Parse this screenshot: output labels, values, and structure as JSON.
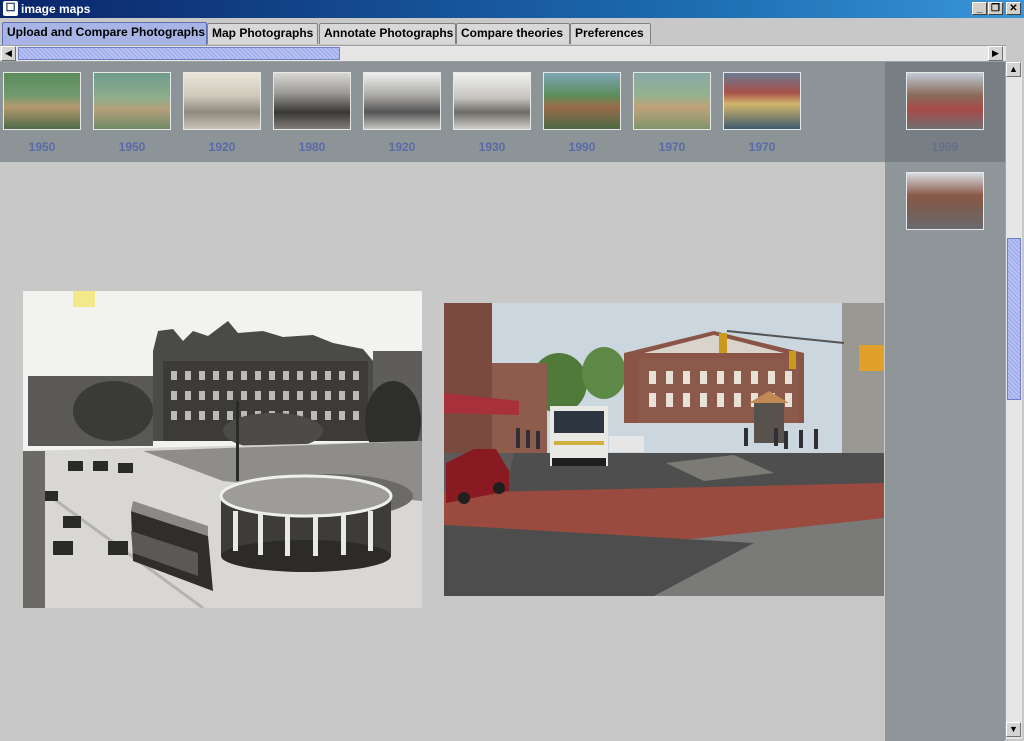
{
  "window": {
    "title": "image maps"
  },
  "tabs": [
    {
      "label": "Upload and Compare Photographs"
    },
    {
      "label": "Map Photographs"
    },
    {
      "label": "Annotate Photographs"
    },
    {
      "label": "Compare theories"
    },
    {
      "label": "Preferences"
    }
  ],
  "thumbnails": [
    {
      "year": "1950"
    },
    {
      "year": "1950"
    },
    {
      "year": "1920"
    },
    {
      "year": "1980"
    },
    {
      "year": "1920"
    },
    {
      "year": "1930"
    },
    {
      "year": "1990"
    },
    {
      "year": "1970"
    },
    {
      "year": "1970"
    }
  ],
  "side_thumbnails": [
    {
      "year": "1999"
    },
    {
      "year": ""
    }
  ],
  "colors": {
    "active_tab": "#a8b4e6",
    "year_label": "#5a6aa8",
    "strip_bg": "#8c9498"
  }
}
